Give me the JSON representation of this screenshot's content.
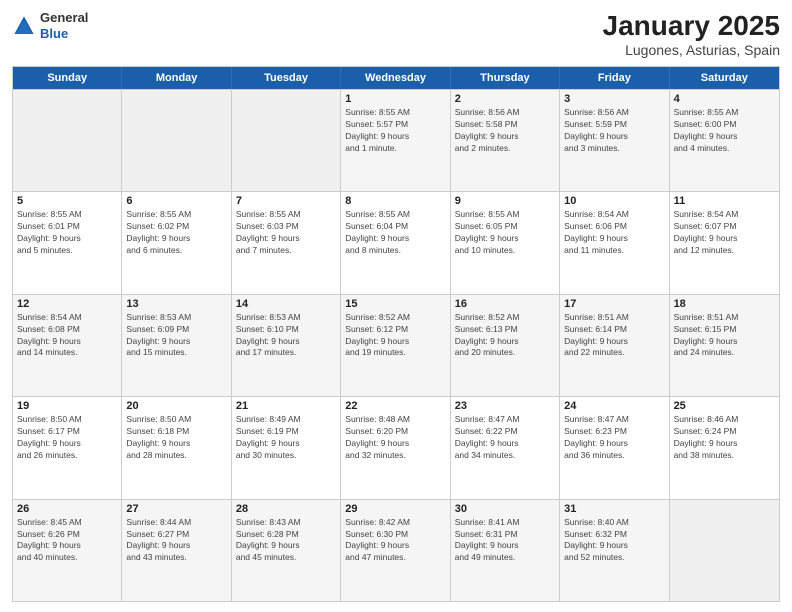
{
  "header": {
    "logo_general": "General",
    "logo_blue": "Blue",
    "title": "January 2025",
    "subtitle": "Lugones, Asturias, Spain"
  },
  "weekdays": [
    "Sunday",
    "Monday",
    "Tuesday",
    "Wednesday",
    "Thursday",
    "Friday",
    "Saturday"
  ],
  "rows": [
    [
      {
        "day": "",
        "info": ""
      },
      {
        "day": "",
        "info": ""
      },
      {
        "day": "",
        "info": ""
      },
      {
        "day": "1",
        "info": "Sunrise: 8:55 AM\nSunset: 5:57 PM\nDaylight: 9 hours\nand 1 minute."
      },
      {
        "day": "2",
        "info": "Sunrise: 8:56 AM\nSunset: 5:58 PM\nDaylight: 9 hours\nand 2 minutes."
      },
      {
        "day": "3",
        "info": "Sunrise: 8:56 AM\nSunset: 5:59 PM\nDaylight: 9 hours\nand 3 minutes."
      },
      {
        "day": "4",
        "info": "Sunrise: 8:55 AM\nSunset: 6:00 PM\nDaylight: 9 hours\nand 4 minutes."
      }
    ],
    [
      {
        "day": "5",
        "info": "Sunrise: 8:55 AM\nSunset: 6:01 PM\nDaylight: 9 hours\nand 5 minutes."
      },
      {
        "day": "6",
        "info": "Sunrise: 8:55 AM\nSunset: 6:02 PM\nDaylight: 9 hours\nand 6 minutes."
      },
      {
        "day": "7",
        "info": "Sunrise: 8:55 AM\nSunset: 6:03 PM\nDaylight: 9 hours\nand 7 minutes."
      },
      {
        "day": "8",
        "info": "Sunrise: 8:55 AM\nSunset: 6:04 PM\nDaylight: 9 hours\nand 8 minutes."
      },
      {
        "day": "9",
        "info": "Sunrise: 8:55 AM\nSunset: 6:05 PM\nDaylight: 9 hours\nand 10 minutes."
      },
      {
        "day": "10",
        "info": "Sunrise: 8:54 AM\nSunset: 6:06 PM\nDaylight: 9 hours\nand 11 minutes."
      },
      {
        "day": "11",
        "info": "Sunrise: 8:54 AM\nSunset: 6:07 PM\nDaylight: 9 hours\nand 12 minutes."
      }
    ],
    [
      {
        "day": "12",
        "info": "Sunrise: 8:54 AM\nSunset: 6:08 PM\nDaylight: 9 hours\nand 14 minutes."
      },
      {
        "day": "13",
        "info": "Sunrise: 8:53 AM\nSunset: 6:09 PM\nDaylight: 9 hours\nand 15 minutes."
      },
      {
        "day": "14",
        "info": "Sunrise: 8:53 AM\nSunset: 6:10 PM\nDaylight: 9 hours\nand 17 minutes."
      },
      {
        "day": "15",
        "info": "Sunrise: 8:52 AM\nSunset: 6:12 PM\nDaylight: 9 hours\nand 19 minutes."
      },
      {
        "day": "16",
        "info": "Sunrise: 8:52 AM\nSunset: 6:13 PM\nDaylight: 9 hours\nand 20 minutes."
      },
      {
        "day": "17",
        "info": "Sunrise: 8:51 AM\nSunset: 6:14 PM\nDaylight: 9 hours\nand 22 minutes."
      },
      {
        "day": "18",
        "info": "Sunrise: 8:51 AM\nSunset: 6:15 PM\nDaylight: 9 hours\nand 24 minutes."
      }
    ],
    [
      {
        "day": "19",
        "info": "Sunrise: 8:50 AM\nSunset: 6:17 PM\nDaylight: 9 hours\nand 26 minutes."
      },
      {
        "day": "20",
        "info": "Sunrise: 8:50 AM\nSunset: 6:18 PM\nDaylight: 9 hours\nand 28 minutes."
      },
      {
        "day": "21",
        "info": "Sunrise: 8:49 AM\nSunset: 6:19 PM\nDaylight: 9 hours\nand 30 minutes."
      },
      {
        "day": "22",
        "info": "Sunrise: 8:48 AM\nSunset: 6:20 PM\nDaylight: 9 hours\nand 32 minutes."
      },
      {
        "day": "23",
        "info": "Sunrise: 8:47 AM\nSunset: 6:22 PM\nDaylight: 9 hours\nand 34 minutes."
      },
      {
        "day": "24",
        "info": "Sunrise: 8:47 AM\nSunset: 6:23 PM\nDaylight: 9 hours\nand 36 minutes."
      },
      {
        "day": "25",
        "info": "Sunrise: 8:46 AM\nSunset: 6:24 PM\nDaylight: 9 hours\nand 38 minutes."
      }
    ],
    [
      {
        "day": "26",
        "info": "Sunrise: 8:45 AM\nSunset: 6:26 PM\nDaylight: 9 hours\nand 40 minutes."
      },
      {
        "day": "27",
        "info": "Sunrise: 8:44 AM\nSunset: 6:27 PM\nDaylight: 9 hours\nand 43 minutes."
      },
      {
        "day": "28",
        "info": "Sunrise: 8:43 AM\nSunset: 6:28 PM\nDaylight: 9 hours\nand 45 minutes."
      },
      {
        "day": "29",
        "info": "Sunrise: 8:42 AM\nSunset: 6:30 PM\nDaylight: 9 hours\nand 47 minutes."
      },
      {
        "day": "30",
        "info": "Sunrise: 8:41 AM\nSunset: 6:31 PM\nDaylight: 9 hours\nand 49 minutes."
      },
      {
        "day": "31",
        "info": "Sunrise: 8:40 AM\nSunset: 6:32 PM\nDaylight: 9 hours\nand 52 minutes."
      },
      {
        "day": "",
        "info": ""
      }
    ]
  ]
}
